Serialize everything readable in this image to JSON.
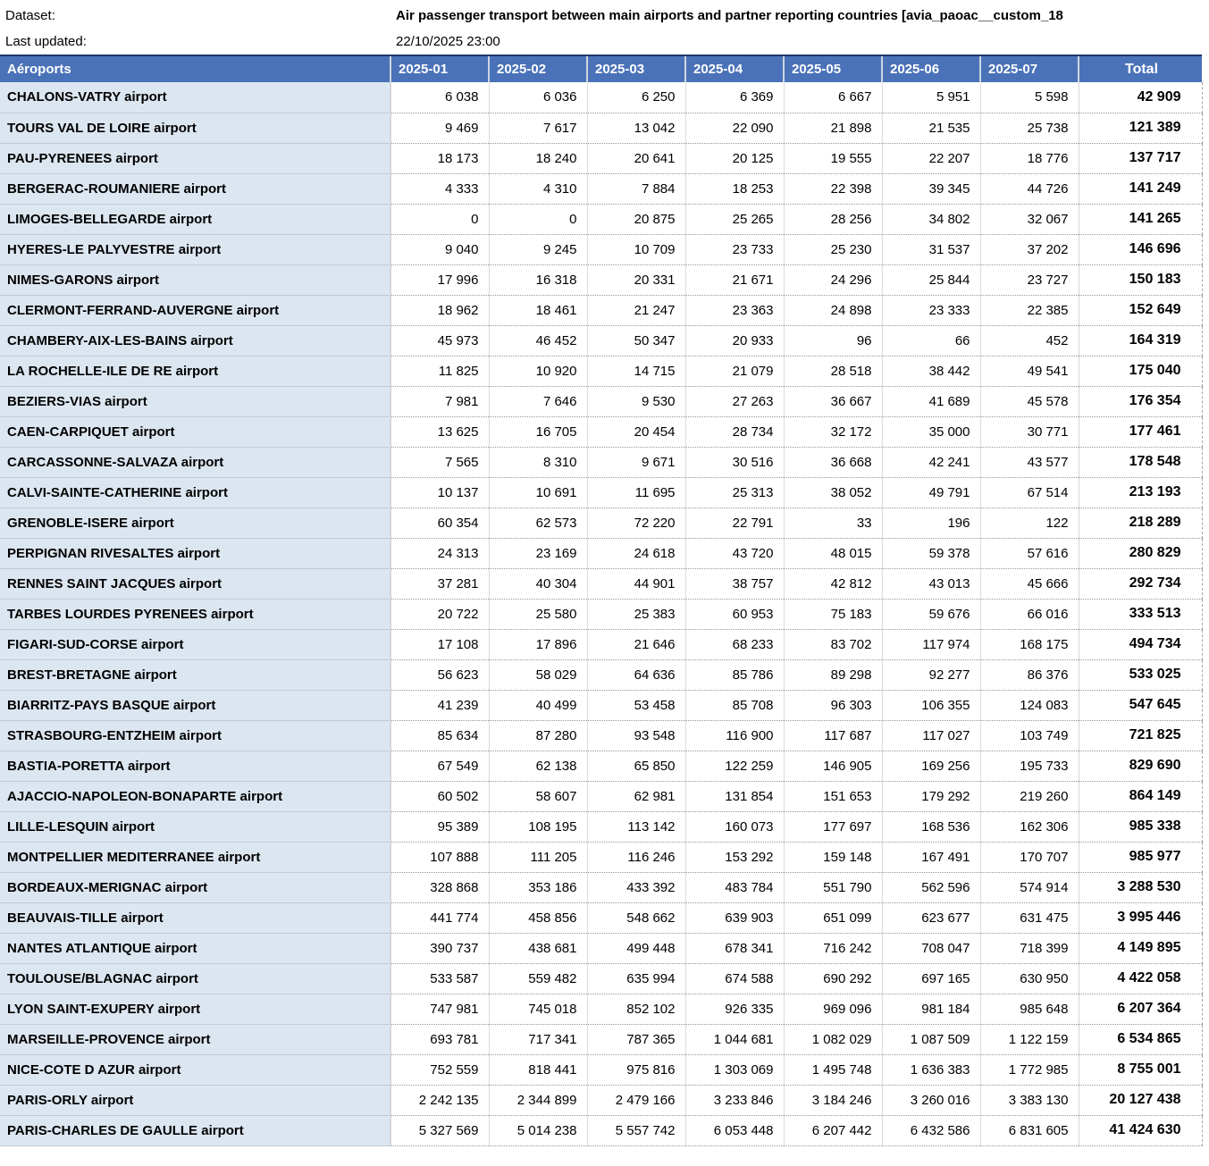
{
  "meta": {
    "dataset_label": "Dataset:",
    "last_updated_label": "Last updated:",
    "last_updated_value": "22/10/2025 23:00"
  },
  "colors": {
    "header_bg": "#4a72b8",
    "header_top_border": "#1f3864",
    "label_column_bg": "#dce6f1",
    "row_separator_dotted": "#969696"
  },
  "chart_data": {
    "type": "table",
    "title": "Air passenger transport between main airports and partner reporting countries [avia_paoac__custom_18",
    "last_updated": "22/10/2025 23:00",
    "number_format": "space thousands separator",
    "columns": [
      "Aéroports",
      "2025-01",
      "2025-02",
      "2025-03",
      "2025-04",
      "2025-05",
      "2025-06",
      "2025-07",
      "Total"
    ],
    "rows": [
      {
        "airport": "CHALONS-VATRY airport",
        "values": [
          6038,
          6036,
          6250,
          6369,
          6667,
          5951,
          5598
        ],
        "total": 42909
      },
      {
        "airport": "TOURS VAL DE LOIRE airport",
        "values": [
          9469,
          7617,
          13042,
          22090,
          21898,
          21535,
          25738
        ],
        "total": 121389
      },
      {
        "airport": "PAU-PYRENEES airport",
        "values": [
          18173,
          18240,
          20641,
          20125,
          19555,
          22207,
          18776
        ],
        "total": 137717
      },
      {
        "airport": "BERGERAC-ROUMANIERE airport",
        "values": [
          4333,
          4310,
          7884,
          18253,
          22398,
          39345,
          44726
        ],
        "total": 141249
      },
      {
        "airport": "LIMOGES-BELLEGARDE airport",
        "values": [
          0,
          0,
          20875,
          25265,
          28256,
          34802,
          32067
        ],
        "total": 141265
      },
      {
        "airport": "HYERES-LE PALYVESTRE airport",
        "values": [
          9040,
          9245,
          10709,
          23733,
          25230,
          31537,
          37202
        ],
        "total": 146696
      },
      {
        "airport": "NIMES-GARONS airport",
        "values": [
          17996,
          16318,
          20331,
          21671,
          24296,
          25844,
          23727
        ],
        "total": 150183
      },
      {
        "airport": "CLERMONT-FERRAND-AUVERGNE airport",
        "values": [
          18962,
          18461,
          21247,
          23363,
          24898,
          23333,
          22385
        ],
        "total": 152649
      },
      {
        "airport": "CHAMBERY-AIX-LES-BAINS airport",
        "values": [
          45973,
          46452,
          50347,
          20933,
          96,
          66,
          452
        ],
        "total": 164319
      },
      {
        "airport": "LA ROCHELLE-ILE DE RE airport",
        "values": [
          11825,
          10920,
          14715,
          21079,
          28518,
          38442,
          49541
        ],
        "total": 175040
      },
      {
        "airport": "BEZIERS-VIAS airport",
        "values": [
          7981,
          7646,
          9530,
          27263,
          36667,
          41689,
          45578
        ],
        "total": 176354
      },
      {
        "airport": "CAEN-CARPIQUET airport",
        "values": [
          13625,
          16705,
          20454,
          28734,
          32172,
          35000,
          30771
        ],
        "total": 177461
      },
      {
        "airport": "CARCASSONNE-SALVAZA airport",
        "values": [
          7565,
          8310,
          9671,
          30516,
          36668,
          42241,
          43577
        ],
        "total": 178548
      },
      {
        "airport": "CALVI-SAINTE-CATHERINE airport",
        "values": [
          10137,
          10691,
          11695,
          25313,
          38052,
          49791,
          67514
        ],
        "total": 213193
      },
      {
        "airport": "GRENOBLE-ISERE airport",
        "values": [
          60354,
          62573,
          72220,
          22791,
          33,
          196,
          122
        ],
        "total": 218289
      },
      {
        "airport": "PERPIGNAN RIVESALTES airport",
        "values": [
          24313,
          23169,
          24618,
          43720,
          48015,
          59378,
          57616
        ],
        "total": 280829
      },
      {
        "airport": "RENNES SAINT JACQUES airport",
        "values": [
          37281,
          40304,
          44901,
          38757,
          42812,
          43013,
          45666
        ],
        "total": 292734
      },
      {
        "airport": "TARBES LOURDES PYRENEES airport",
        "values": [
          20722,
          25580,
          25383,
          60953,
          75183,
          59676,
          66016
        ],
        "total": 333513
      },
      {
        "airport": "FIGARI-SUD-CORSE airport",
        "values": [
          17108,
          17896,
          21646,
          68233,
          83702,
          117974,
          168175
        ],
        "total": 494734
      },
      {
        "airport": "BREST-BRETAGNE airport",
        "values": [
          56623,
          58029,
          64636,
          85786,
          89298,
          92277,
          86376
        ],
        "total": 533025
      },
      {
        "airport": "BIARRITZ-PAYS BASQUE airport",
        "values": [
          41239,
          40499,
          53458,
          85708,
          96303,
          106355,
          124083
        ],
        "total": 547645
      },
      {
        "airport": "STRASBOURG-ENTZHEIM airport",
        "values": [
          85634,
          87280,
          93548,
          116900,
          117687,
          117027,
          103749
        ],
        "total": 721825
      },
      {
        "airport": "BASTIA-PORETTA airport",
        "values": [
          67549,
          62138,
          65850,
          122259,
          146905,
          169256,
          195733
        ],
        "total": 829690
      },
      {
        "airport": "AJACCIO-NAPOLEON-BONAPARTE airport",
        "values": [
          60502,
          58607,
          62981,
          131854,
          151653,
          179292,
          219260
        ],
        "total": 864149
      },
      {
        "airport": "LILLE-LESQUIN airport",
        "values": [
          95389,
          108195,
          113142,
          160073,
          177697,
          168536,
          162306
        ],
        "total": 985338
      },
      {
        "airport": "MONTPELLIER MEDITERRANEE airport",
        "values": [
          107888,
          111205,
          116246,
          153292,
          159148,
          167491,
          170707
        ],
        "total": 985977
      },
      {
        "airport": "BORDEAUX-MERIGNAC airport",
        "values": [
          328868,
          353186,
          433392,
          483784,
          551790,
          562596,
          574914
        ],
        "total": 3288530
      },
      {
        "airport": "BEAUVAIS-TILLE airport",
        "values": [
          441774,
          458856,
          548662,
          639903,
          651099,
          623677,
          631475
        ],
        "total": 3995446
      },
      {
        "airport": "NANTES ATLANTIQUE airport",
        "values": [
          390737,
          438681,
          499448,
          678341,
          716242,
          708047,
          718399
        ],
        "total": 4149895
      },
      {
        "airport": "TOULOUSE/BLAGNAC airport",
        "values": [
          533587,
          559482,
          635994,
          674588,
          690292,
          697165,
          630950
        ],
        "total": 4422058
      },
      {
        "airport": "LYON SAINT-EXUPERY airport",
        "values": [
          747981,
          745018,
          852102,
          926335,
          969096,
          981184,
          985648
        ],
        "total": 6207364
      },
      {
        "airport": "MARSEILLE-PROVENCE airport",
        "values": [
          693781,
          717341,
          787365,
          1044681,
          1082029,
          1087509,
          1122159
        ],
        "total": 6534865
      },
      {
        "airport": "NICE-COTE D AZUR airport",
        "values": [
          752559,
          818441,
          975816,
          1303069,
          1495748,
          1636383,
          1772985
        ],
        "total": 8755001
      },
      {
        "airport": "PARIS-ORLY airport",
        "values": [
          2242135,
          2344899,
          2479166,
          3233846,
          3184246,
          3260016,
          3383130
        ],
        "total": 20127438
      },
      {
        "airport": "PARIS-CHARLES DE GAULLE airport",
        "values": [
          5327569,
          5014238,
          5557742,
          6053448,
          6207442,
          6432586,
          6831605
        ],
        "total": 41424630
      }
    ]
  }
}
